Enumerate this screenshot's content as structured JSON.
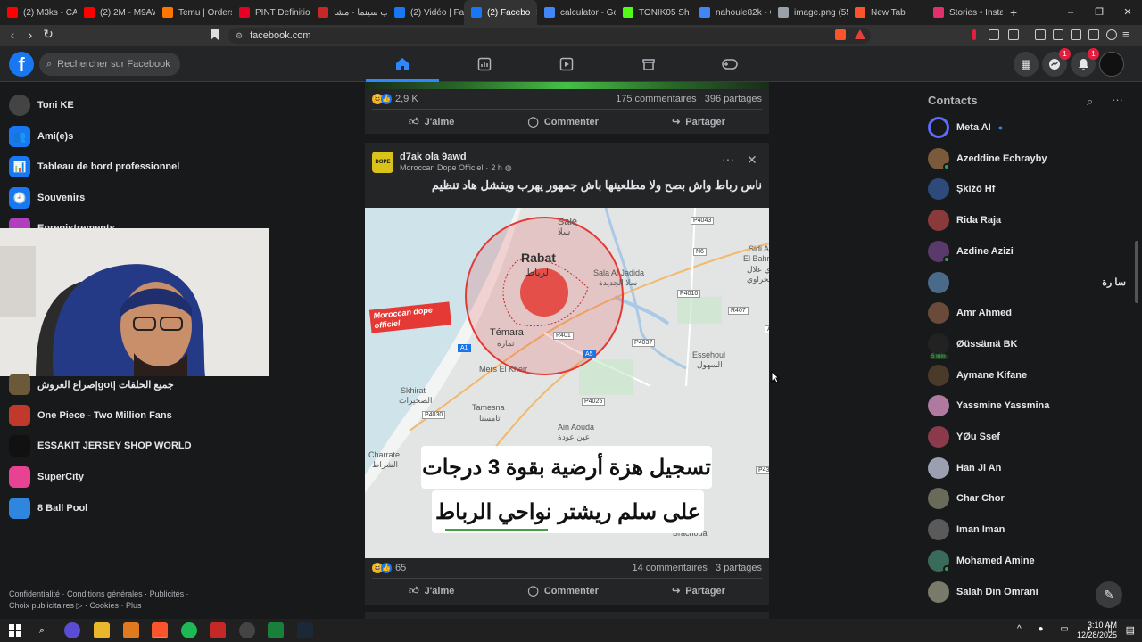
{
  "browser": {
    "tabs": [
      {
        "label": "(2) M3ks - CAL",
        "color": "#ff0000"
      },
      {
        "label": "(2) 2M - M9AW",
        "color": "#ff0000"
      },
      {
        "label": "Temu | Orders",
        "color": "#fb7701"
      },
      {
        "label": "PINT Definition",
        "color": "#e60023"
      },
      {
        "label": "توب سينما - مشا",
        "color": "#c62828"
      },
      {
        "label": "(2) Vidéo | Face",
        "color": "#1877f2"
      },
      {
        "label": "(2) Facebo",
        "color": "#1877f2",
        "active": true
      },
      {
        "label": "calculator - Goo",
        "color": "#4285f4"
      },
      {
        "label": "TONIK05 Sh",
        "color": "#53fc18"
      },
      {
        "label": "nahoule82k - G",
        "color": "#4285f4"
      },
      {
        "label": "image.png (55€",
        "color": "#9aa0a6"
      },
      {
        "label": "New Tab",
        "color": "#fb542b"
      },
      {
        "label": "Stories • Instag",
        "color": "#e1306c"
      }
    ],
    "new_tab": "+",
    "url": "facebook.com",
    "close_tab": "✕"
  },
  "facebook": {
    "logo": "f",
    "search_placeholder": "Rechercher sur Facebook",
    "messenger_badge": "1",
    "notifications_badge": "1"
  },
  "left_sidebar": {
    "items": [
      {
        "label": "Toni KE",
        "color": "#444"
      },
      {
        "label": "Ami(e)s",
        "color": "#1877f2",
        "icon": "👥"
      },
      {
        "label": "Tableau de bord professionnel",
        "color": "#1877f2",
        "icon": "📊"
      },
      {
        "label": "Souvenirs",
        "color": "#1877f2",
        "icon": "🕘"
      },
      {
        "label": "Enregistrements",
        "color": "#b03fbf"
      }
    ],
    "shortcuts": [
      {
        "label": "صراع العروش|got| جميع الحلقات",
        "color": "#6b5a3a"
      },
      {
        "label": "One Piece - Two Million Fans",
        "color": "#c0392b"
      },
      {
        "label": "ESSAKIT JERSEY SHOP WORLD",
        "color": "#111"
      },
      {
        "label": "SuperCity",
        "color": "#e84393"
      },
      {
        "label": "8 Ball Pool",
        "color": "#2e86de"
      }
    ],
    "footer_line1": "Confidentialité · Conditions générales · Publicités ·",
    "footer_line2": "Choix publicitaires ▷ · Cookies · Plus"
  },
  "feed": {
    "prev_post": {
      "reactions": "2,9 K",
      "comments": "175 commentaires",
      "shares": "396 partages"
    },
    "post": {
      "author": "d7ak ola 9awd",
      "page": "Moroccan Dope Officiel",
      "time": "2 h",
      "caption": "ناس رباط واش بصح ولا مطلعينها باش جمهور يهرب ويفشل هاد تنظيم",
      "image_watermark": "Moroccan dope officiel",
      "image_headline_1": "تسجيل هزة أرضية بقوة 3 درجات",
      "image_headline_2": "على سلم ريشتر نواحي الرباط",
      "map_labels": {
        "sale_fr": "Salé",
        "sale_ar": "سلا",
        "rabat_fr": "Rabat",
        "rabat_ar": "الرباط",
        "sala_fr": "Sala Al Jadida",
        "sala_ar": "سلا الجديدة",
        "temara_fr": "Témara",
        "temara_ar": "تمارة",
        "mers": "Mers El Kheir",
        "skhirat_fr": "Skhirat",
        "skhirat_ar": "الصخيرات",
        "tamesna_fr": "Tamesna",
        "tamesna_ar": "تامسنا",
        "ainaouda_fr": "Ain Aouda",
        "ainaouda_ar": "عين عودة",
        "essehoul_fr": "Essehoul",
        "essehoul_ar": "السهول",
        "sidi_fr": "Sidi A",
        "sidi_fr2": "El Bahr",
        "sidi_ar": "سيدي علال",
        "sidi_ar2": "البحراوي",
        "charrate_fr": "Charrate",
        "charrate_ar": "الشراط",
        "brachoua": "Brachoua",
        "roads": [
          "P4043",
          "N6",
          "P4010",
          "R407",
          "R401",
          "P4037",
          "A1",
          "A5",
          "P4030",
          "P4025",
          "A",
          "P43"
        ]
      },
      "reactions": "65",
      "comments": "14 commentaires",
      "shares": "3 partages"
    },
    "like_label": "J'aime",
    "comment_label": "Commenter",
    "share_label": "Partager",
    "more": "···",
    "close": "✕"
  },
  "contacts": {
    "title": "Contacts",
    "items": [
      {
        "name": "Meta AI",
        "color": "#5b6cff",
        "verified": "●"
      },
      {
        "name": "Azeddine Echrayby",
        "color": "#7a5a3a",
        "online": true
      },
      {
        "name": "Şkĭžō Hf",
        "color": "#2e4a7a"
      },
      {
        "name": "Rida Raja",
        "color": "#8a3a3a"
      },
      {
        "name": "Azdine Azizi",
        "color": "#5a3a6a",
        "online": true
      },
      {
        "name": "سا رة",
        "color": "#4a6a8a"
      },
      {
        "name": "Amr Ahmed",
        "color": "#6a4a3a"
      },
      {
        "name": "Øüssämä BK",
        "color": "#222",
        "away": "5 min"
      },
      {
        "name": "Aymane Kifane",
        "color": "#4a3a2a"
      },
      {
        "name": "Yassmine Yassmina",
        "color": "#b07aa0"
      },
      {
        "name": "YØu Ssef",
        "color": "#8a3a4a"
      },
      {
        "name": "Han Ji An",
        "color": "#9aa0b0"
      },
      {
        "name": "Char Chor",
        "color": "#6a6a5a"
      },
      {
        "name": "Iman Iman",
        "color": "#5a5a5a"
      },
      {
        "name": "Mohamed Amine",
        "color": "#3a6a5a",
        "online": true
      },
      {
        "name": "Salah Din Omrani",
        "color": "#7a7a6a"
      }
    ]
  },
  "taskbar": {
    "time": "3:10 AM",
    "date": "12/28/2025"
  }
}
